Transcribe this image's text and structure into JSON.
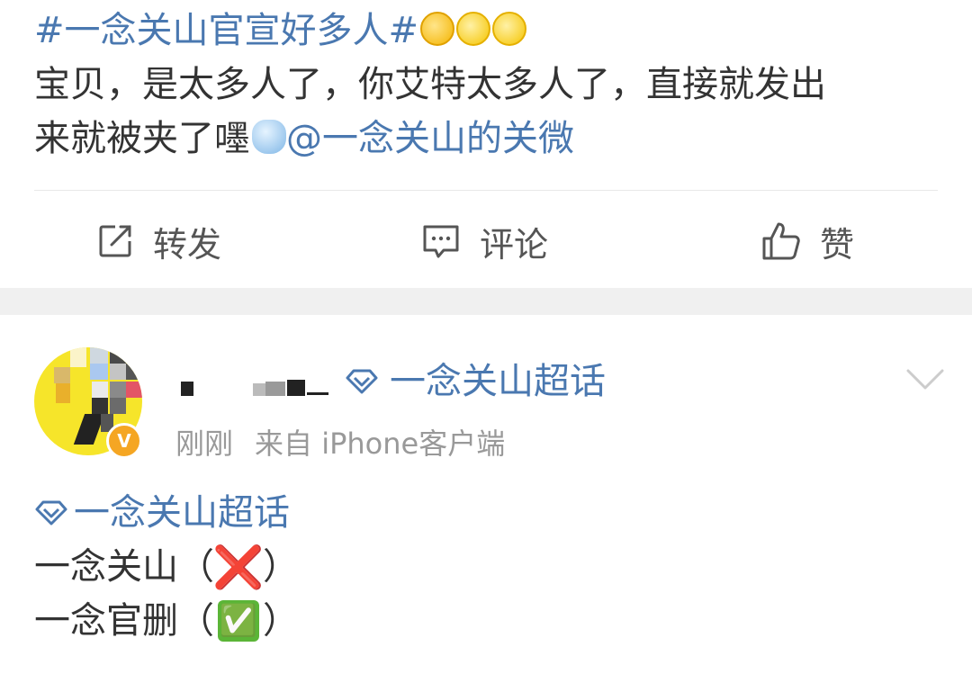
{
  "post1": {
    "hashtag": "#一念关山官宣好多人#",
    "line2": "宝贝，是太多人了，你艾特太多人了，直接就发出",
    "line3_text": "来就被夹了嚜",
    "mention": "@一念关山的关微",
    "emojis": [
      "zipped-mouth-emoji",
      "crying-emoji",
      "laughing-tears-emoji"
    ],
    "actions": {
      "repost": "转发",
      "comment": "评论",
      "like": "赞"
    }
  },
  "post2": {
    "topic_tag": "一念关山超话",
    "timestamp": "刚刚",
    "source": "来自 iPhone客户端",
    "verified_badge": "V",
    "body_topic": "一念关山超话",
    "line1_text": "一念关山",
    "line1_mark": "❌",
    "line2_text": "一念官删",
    "line2_mark": "✅",
    "paren_open": "（",
    "paren_close": "）"
  },
  "colors": {
    "link_blue": "#4a78b0",
    "text": "#333333",
    "meta_gray": "#999999",
    "separator": "#f0f0f0",
    "badge_orange": "#f5a623"
  }
}
